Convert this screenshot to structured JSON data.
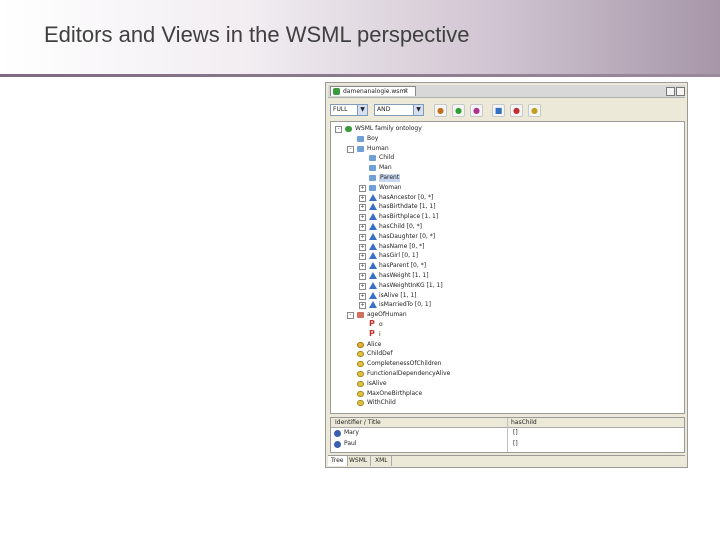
{
  "slide": {
    "title": "Editors and Views in the WSML perspective"
  },
  "window": {
    "tab_label": "damenanalogie.wsml",
    "toolbar": {
      "combo1_value": "FULL",
      "combo2_value": "AND"
    },
    "tree": [
      {
        "label": "WSML family ontology",
        "icon": "ontology-icon",
        "indent": 0,
        "expander": "-"
      },
      {
        "label": "Boy",
        "icon": "folder-icon",
        "indent": 1,
        "expander": ""
      },
      {
        "label": "Human",
        "icon": "folder-icon",
        "indent": 1,
        "expander": "-"
      },
      {
        "label": "Child",
        "icon": "folder-icon",
        "indent": 2,
        "expander": ""
      },
      {
        "label": "Man",
        "icon": "folder-icon",
        "indent": 2,
        "expander": ""
      },
      {
        "label": "Parent",
        "icon": "folder-icon",
        "indent": 2,
        "expander": "",
        "selected": true
      },
      {
        "label": "Woman",
        "icon": "folder-icon",
        "indent": 2,
        "expander": "+"
      },
      {
        "label": "hasAncestor [0, *]",
        "icon": "attribute-icon",
        "indent": 2,
        "expander": "+"
      },
      {
        "label": "hasBirthdate [1, 1]",
        "icon": "attribute-icon",
        "indent": 2,
        "expander": "+"
      },
      {
        "label": "hasBirthplace [1, 1]",
        "icon": "attribute-icon",
        "indent": 2,
        "expander": "+"
      },
      {
        "label": "hasChild [0, *]",
        "icon": "attribute-icon",
        "indent": 2,
        "expander": "+"
      },
      {
        "label": "hasDaughter [0, *]",
        "icon": "attribute-icon",
        "indent": 2,
        "expander": "+"
      },
      {
        "label": "hasName [0, *]",
        "icon": "attribute-icon",
        "indent": 2,
        "expander": "+"
      },
      {
        "label": "hasGirl [0, 1]",
        "icon": "attribute-icon",
        "indent": 2,
        "expander": "+"
      },
      {
        "label": "hasParent [0, *]",
        "icon": "attribute-icon",
        "indent": 2,
        "expander": "+"
      },
      {
        "label": "hasWeight [1, 1]",
        "icon": "attribute-icon",
        "indent": 2,
        "expander": "+"
      },
      {
        "label": "hasWeightInKG [1, 1]",
        "icon": "attribute-icon",
        "indent": 2,
        "expander": "+"
      },
      {
        "label": "isAlive [1, 1]",
        "icon": "attribute-icon",
        "indent": 2,
        "expander": "+"
      },
      {
        "label": "isMarriedTo [0, 1]",
        "icon": "attribute-icon",
        "indent": 2,
        "expander": "+"
      },
      {
        "label": "ageOfHuman",
        "icon": "red-folder-icon",
        "indent": 1,
        "expander": "-"
      },
      {
        "label": "o",
        "icon": "parameter-icon",
        "indent": 2,
        "expander": ""
      },
      {
        "label": "i",
        "icon": "parameter-icon",
        "indent": 2,
        "expander": ""
      },
      {
        "label": "Alice",
        "icon": "instance-icon",
        "indent": 1,
        "expander": ""
      },
      {
        "label": "ChildDef",
        "icon": "axiom-icon",
        "indent": 1,
        "expander": ""
      },
      {
        "label": "CompletenessOfChildren",
        "icon": "axiom-icon",
        "indent": 1,
        "expander": ""
      },
      {
        "label": "FunctionalDependencyAlive",
        "icon": "axiom-icon",
        "indent": 1,
        "expander": ""
      },
      {
        "label": "IsAlive",
        "icon": "axiom-icon",
        "indent": 1,
        "expander": ""
      },
      {
        "label": "MaxOneBirthplace",
        "icon": "axiom-icon",
        "indent": 1,
        "expander": ""
      },
      {
        "label": "WithChild",
        "icon": "axiom-icon",
        "indent": 1,
        "expander": ""
      }
    ],
    "table": {
      "col1_header": "Identifier / Title",
      "col2_header": "hasChild",
      "rows": [
        {
          "name": "Mary",
          "value": "[]"
        },
        {
          "name": "Paul",
          "value": "[]"
        }
      ]
    },
    "bottom_tabs": [
      "Tree",
      "WSML",
      "XML"
    ]
  }
}
